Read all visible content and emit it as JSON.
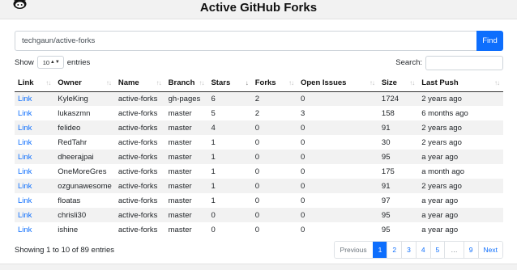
{
  "header": {
    "title": "Active GitHub Forks"
  },
  "search": {
    "repo_value": "techgaun/active-forks",
    "find_label": "Find"
  },
  "length": {
    "show_label": "Show",
    "selected": "10",
    "entries_label": "entries"
  },
  "table_search": {
    "label": "Search:",
    "value": ""
  },
  "table": {
    "columns": [
      "Link",
      "Owner",
      "Name",
      "Branch",
      "Stars",
      "Forks",
      "Open Issues",
      "Size",
      "Last Push"
    ],
    "rows": [
      [
        "Link",
        "KyleKing",
        "active-forks",
        "gh-pages",
        "6",
        "2",
        "0",
        "1724",
        "2 years ago"
      ],
      [
        "Link",
        "lukaszmn",
        "active-forks",
        "master",
        "5",
        "2",
        "3",
        "158",
        "6 months ago"
      ],
      [
        "Link",
        "felideo",
        "active-forks",
        "master",
        "4",
        "0",
        "0",
        "91",
        "2 years ago"
      ],
      [
        "Link",
        "RedTahr",
        "active-forks",
        "master",
        "1",
        "0",
        "0",
        "30",
        "2 years ago"
      ],
      [
        "Link",
        "dheerajpai",
        "active-forks",
        "master",
        "1",
        "0",
        "0",
        "95",
        "a year ago"
      ],
      [
        "Link",
        "OneMoreGres",
        "active-forks",
        "master",
        "1",
        "0",
        "0",
        "175",
        "a month ago"
      ],
      [
        "Link",
        "ozgunawesome",
        "active-forks",
        "master",
        "1",
        "0",
        "0",
        "91",
        "2 years ago"
      ],
      [
        "Link",
        "floatas",
        "active-forks",
        "master",
        "1",
        "0",
        "0",
        "97",
        "a year ago"
      ],
      [
        "Link",
        "chrisli30",
        "active-forks",
        "master",
        "0",
        "0",
        "0",
        "95",
        "a year ago"
      ],
      [
        "Link",
        "ishine",
        "active-forks",
        "master",
        "0",
        "0",
        "0",
        "95",
        "a year ago"
      ]
    ]
  },
  "info": {
    "text": "Showing 1 to 10 of 89 entries"
  },
  "pagination": {
    "previous": "Previous",
    "pages": [
      "1",
      "2",
      "3",
      "4",
      "5",
      "…",
      "9"
    ],
    "next": "Next",
    "active_page": "1"
  },
  "icons": {
    "logo": "github-octocat-icon",
    "select_caret": "updown-caret-icon",
    "sort": "sort-arrows-icon"
  },
  "colors": {
    "accent": "#0d6efd",
    "header_bg": "#f2f2f2",
    "stripe": "#f2f2f2"
  }
}
